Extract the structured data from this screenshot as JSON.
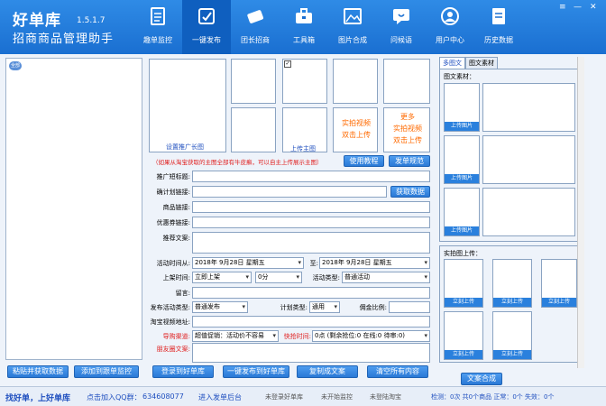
{
  "header": {
    "brand_name": "好单库",
    "version": "1.5.1.7",
    "subtitle": "招商商品管理助手",
    "nav": [
      {
        "label": "趣单监控",
        "icon": "document-icon"
      },
      {
        "label": "一键发布",
        "icon": "publish-icon"
      },
      {
        "label": "团长招商",
        "icon": "ticket-icon"
      },
      {
        "label": "工具箱",
        "icon": "toolbox-icon"
      },
      {
        "label": "图片合成",
        "icon": "image-icon"
      },
      {
        "label": "问候语",
        "icon": "chat-icon"
      },
      {
        "label": "用户中心",
        "icon": "user-icon"
      },
      {
        "label": "历史数据",
        "icon": "history-icon"
      }
    ],
    "window": {
      "menu": "≡",
      "min": "—",
      "close": "✕"
    }
  },
  "left": {
    "tag": "全部",
    "paste_button": "粘贴并获取数据",
    "add_monitor_button": "添加到跟单监控"
  },
  "mid": {
    "promo_image": "设置推广长图",
    "main_image": "上传主图",
    "video1": [
      "实拍视频",
      "双击上传"
    ],
    "more": [
      "更多",
      "实拍视频",
      "双击上传"
    ],
    "hint": "（如果从淘宝获取的主图全部有牛皮癣，可以自主上传展示主图）",
    "tutorial_button": "使用教程",
    "rules_button": "发单规范",
    "labels": {
      "title": "推广短标题:",
      "plan_link": "确计划链接:",
      "product_link": "商品链接:",
      "coupon_link": "优惠券链接:",
      "copy": "推荐文案:",
      "activity_time": "活动时间从:",
      "to": "至:",
      "on_time": "上架时间:",
      "activity_type": "活动类型:",
      "remark": "留言:",
      "publish_type": "发布活动类型:",
      "plan_type": "计划类型:",
      "commission": "佣金比例:",
      "video_url": "淘宝视频地址:",
      "snap_channel": "导购渠道:",
      "snap_time": "快抢时间:",
      "moments_copy": "朋友圈文案:"
    },
    "get_data_button": "获取数据",
    "date_from": "2018年 9月28日  星期五",
    "date_to": "2018年 9月28日  星期五",
    "on_time_value": "立即上架",
    "on_time_minute": "0分",
    "activity_type_value": "普通活动",
    "publish_type_value": "普通发布",
    "plan_type_value": "通用",
    "snap_channel_value": "超值促销：活动价不容易",
    "snap_time_value": "0点 (剩余抢位:0 在线:0 待审:0)",
    "buttons": {
      "login": "登录到好单库",
      "publish": "一键发布到好单库",
      "copy": "复制成文案",
      "clear": "清空所有内容"
    }
  },
  "right": {
    "tabs": [
      "多图文",
      "图文素材"
    ],
    "material_label": "图文素材：",
    "upload_label": "上传图片",
    "real_upload_label": "实拍图上传：",
    "instant_upload": "立刻上传",
    "compose_button": "文案合成"
  },
  "status": {
    "slogan": "找好单，上好单库",
    "qq_prefix": "点击加入QQ群：",
    "qq": "634608077",
    "backend": "进入发单后台",
    "login_state": "未登录好单库",
    "monitor_state": "未开始监控",
    "taobao_state": "未登陆淘宝",
    "counts": "检测：0次 共0个商品 正常：0个 失效：0个"
  },
  "colors": {
    "header": "#1a6fd1",
    "accent": "#2a80dd",
    "orange": "#ff6a00",
    "red": "#e02020"
  }
}
